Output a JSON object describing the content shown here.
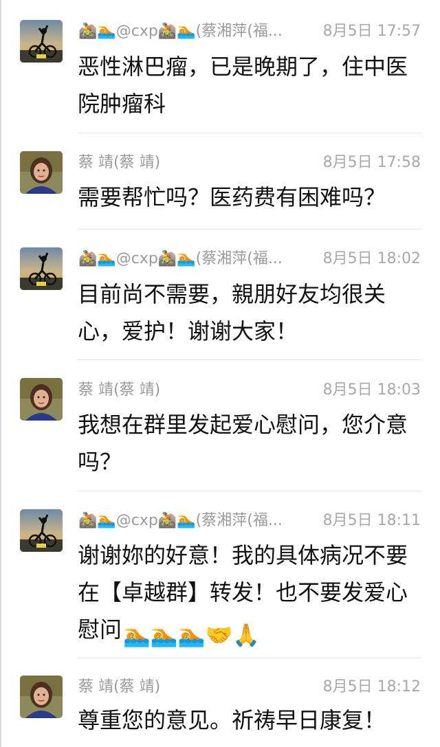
{
  "messages": [
    {
      "sender": "🚵🏊@cxp🚵🏊(蔡湘萍(福...",
      "time": "8月5日 17:57",
      "text": "恶性淋巴瘤，已是晚期了，住中医院肿瘤科",
      "avatar": "cyclist-avatar"
    },
    {
      "sender": "蔡 靖(蔡 靖)",
      "time": "8月5日 17:58",
      "text": "需要帮忙吗？医药费有困难吗？",
      "avatar": "woman-avatar"
    },
    {
      "sender": "🚵🏊@cxp🚵🏊(蔡湘萍(福...",
      "time": "8月5日 18:02",
      "text": "目前尚不需要，親朋好友均很关心，爱护！谢谢大家！",
      "avatar": "cyclist-avatar"
    },
    {
      "sender": "蔡 靖(蔡 靖)",
      "time": "8月5日 18:03",
      "text": "我想在群里发起爱心慰问，您介意吗？",
      "avatar": "woman-avatar"
    },
    {
      "sender": "🚵🏊@cxp🚵🏊(蔡湘萍(福...",
      "time": "8月5日 18:11",
      "text": "谢谢妳的好意！我的具体病况不要在【卓越群】转发！也不要发爱心慰问",
      "emojis": "🏊🏊🏊🤝🙏",
      "avatar": "cyclist-avatar"
    },
    {
      "sender": "蔡 靖(蔡 靖)",
      "time": "8月5日 18:12",
      "text": "尊重您的意见。祈祷早日康复！",
      "avatar": "woman-avatar"
    }
  ]
}
